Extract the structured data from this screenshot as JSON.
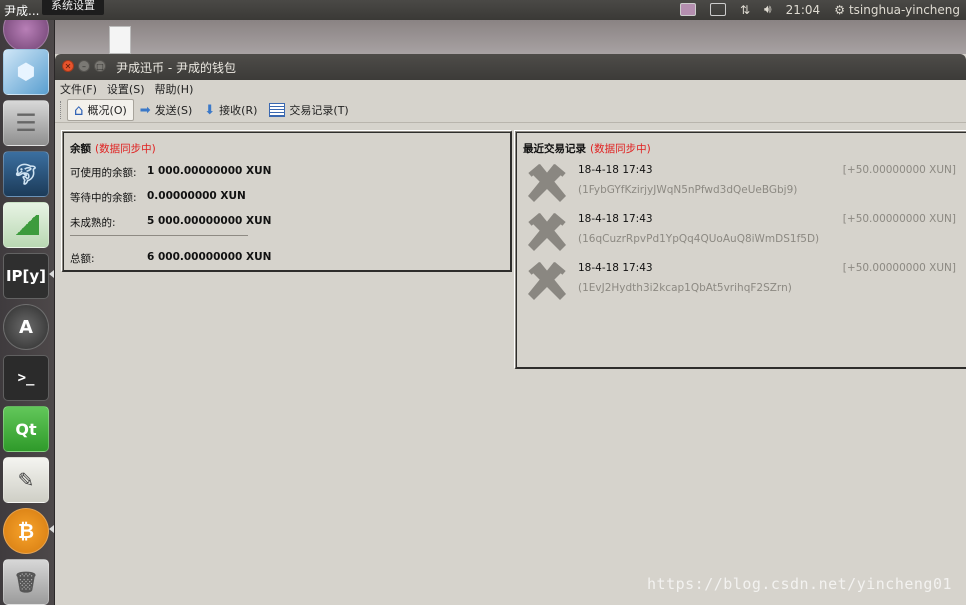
{
  "top_panel": {
    "app_title": "尹成...",
    "tooltip": "系统设置",
    "clock": "21:04",
    "username": "tsinghua-yincheng"
  },
  "launcher": {
    "items": [
      {
        "name": "dash-home-icon",
        "label": ""
      },
      {
        "name": "virtualbox-icon",
        "label": ""
      },
      {
        "name": "database-icon",
        "label": ""
      },
      {
        "name": "mysql-workbench-icon",
        "label": ""
      },
      {
        "name": "spreadsheet-icon",
        "label": ""
      },
      {
        "name": "ipython-icon",
        "label": "IP[y]"
      },
      {
        "name": "software-updater-icon",
        "label": "A"
      },
      {
        "name": "terminal-icon",
        "label": ">_"
      },
      {
        "name": "qt-creator-icon",
        "label": "Qt"
      },
      {
        "name": "text-editor-icon",
        "label": ""
      },
      {
        "name": "bitcoin-icon",
        "label": "₿"
      },
      {
        "name": "trash-icon",
        "label": ""
      }
    ]
  },
  "window": {
    "title": "尹成迅币 - 尹成的钱包",
    "menu": [
      "文件(F)",
      "设置(S)",
      "帮助(H)"
    ],
    "toolbar": [
      {
        "label": "概况(O)",
        "icon": "home-icon",
        "active": true
      },
      {
        "label": "发送(S)",
        "icon": "send-arrow-icon",
        "active": false
      },
      {
        "label": "接收(R)",
        "icon": "receive-arrow-icon",
        "active": false
      },
      {
        "label": "交易记录(T)",
        "icon": "list-icon",
        "active": false
      }
    ]
  },
  "balance": {
    "title": "余额",
    "sync_note": "(数据同步中)",
    "available_label": "可使用的余额:",
    "available_value": "1 000.00000000 XUN",
    "pending_label": "等待中的余额:",
    "pending_value": "0.00000000 XUN",
    "immature_label": "未成熟的:",
    "immature_value": "5 000.00000000 XUN",
    "total_label": "总额:",
    "total_value": "6 000.00000000 XUN"
  },
  "recent": {
    "title": "最近交易记录",
    "sync_note": "(数据同步中)",
    "transactions": [
      {
        "date": "18-4-18 17:43",
        "address": "(1FybGYfKzirjyJWqN5nPfwd3dQeUeBGbj9)",
        "amount": "[+50.00000000 XUN]"
      },
      {
        "date": "18-4-18 17:43",
        "address": "(16qCuzrRpvPd1YpQq4QUoAuQ8iWmDS1f5D)",
        "amount": "[+50.00000000 XUN]"
      },
      {
        "date": "18-4-18 17:43",
        "address": "(1EvJ2Hydth3i2kcap1QbAt5vrihqF2SZrn)",
        "amount": "[+50.00000000 XUN]"
      }
    ]
  },
  "watermark": "https://blog.csdn.net/yincheng01"
}
